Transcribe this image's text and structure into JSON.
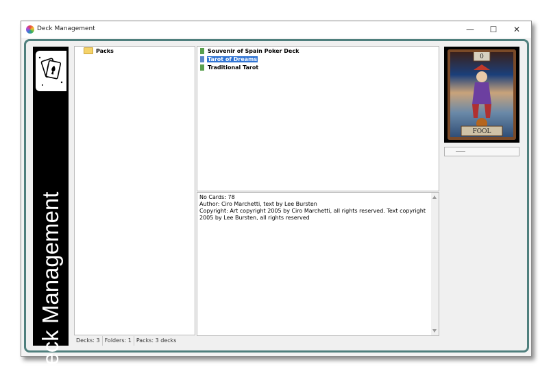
{
  "window": {
    "title": "Deck Management",
    "minimize_glyph": "—",
    "maximize_glyph": "☐",
    "close_glyph": "✕"
  },
  "sidebar": {
    "title": "Deck Management",
    "logo_icon": "playing-cards-icon"
  },
  "tree": {
    "root_label": "Packs",
    "root_icon": "folder-icon"
  },
  "decks": [
    {
      "name": "Souvenir of Spain Poker Deck",
      "selected": false
    },
    {
      "name": "Tarot of Dreams",
      "selected": true
    },
    {
      "name": "Traditional Tarot",
      "selected": false
    }
  ],
  "info": {
    "line1": "No Cards: 78",
    "line2": "Author: Ciro Marchetti, text by Lee Bursten",
    "line3": "Copyright: Art copyright 2005 by Ciro Marchetti, all rights reserved. Text copyright 2005 by Lee Bursten, all rights reserved"
  },
  "status": {
    "decks": "Decks: 3",
    "folders": "Folders: 1",
    "packs": "Packs: 3 decks"
  },
  "preview": {
    "card_number": "0",
    "card_name": "FOOL"
  },
  "colors": {
    "frame": "#4f7f7d",
    "selection": "#2f73d3",
    "sidebar_bg": "#000000"
  }
}
